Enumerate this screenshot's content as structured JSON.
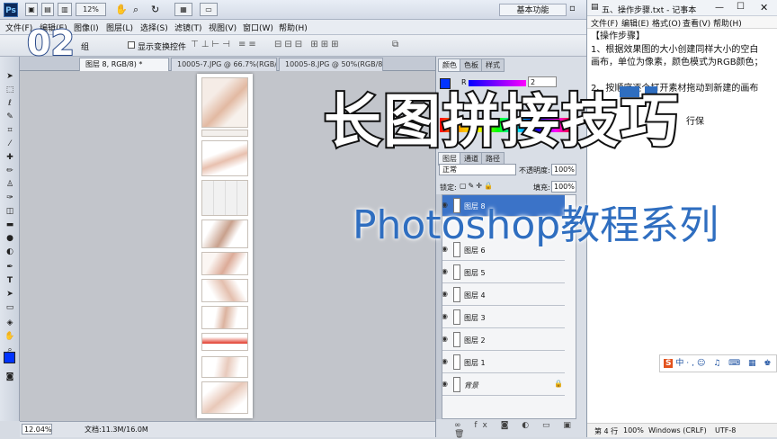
{
  "ps": {
    "logo": "Ps",
    "zoom_select": "12%",
    "workspace": "基本功能",
    "menu": [
      "文件(F)",
      "编辑(E)",
      "图像(I)",
      "图层(L)",
      "选择(S)",
      "滤镜(T)",
      "视图(V)",
      "窗口(W)",
      "帮助(H)"
    ],
    "options": {
      "group_label": "组",
      "transform_label": "显示变换控件"
    },
    "tabs": [
      "图层 8, RGB/8) *",
      "10005-7.JPG @ 66.7%(RGB/8#)",
      "10005-8.JPG @ 50%(RGB/8#)"
    ],
    "status": {
      "zoom": "12.04%",
      "doc_size": "文档:11.3M/16.0M"
    },
    "color_panel": {
      "tabs": [
        "颜色",
        "色板",
        "样式"
      ],
      "r_label": "R",
      "r_value": "2"
    },
    "layers_panel": {
      "tabs": [
        "图层",
        "通道",
        "路径"
      ],
      "blend_mode": "正常",
      "opacity_label": "不透明度:",
      "opacity": "100%",
      "lock_label": "锁定:",
      "fill_label": "填充:",
      "fill": "100%",
      "layers": [
        {
          "name": "图层 8",
          "selected": true
        },
        {
          "name": "图层 6",
          "selected": false
        },
        {
          "name": "图层 5",
          "selected": false
        },
        {
          "name": "图层 4",
          "selected": false
        },
        {
          "name": "图层 3",
          "selected": false
        },
        {
          "name": "图层 2",
          "selected": false
        },
        {
          "name": "图层 1",
          "selected": false
        },
        {
          "name": "背景",
          "selected": false
        }
      ]
    }
  },
  "notepad": {
    "title": "五、操作步骤.txt - 记事本",
    "menu": [
      "文件(F)",
      "编辑(E)",
      "格式(O)",
      "查看(V)",
      "帮助(H)"
    ],
    "lines": [
      "【操作步骤】",
      "1、根据效果图的大小创建同样大小的空白",
      "画布，单位为像素，颜色模式为RGB颜色；",
      "",
      "2、按顺序逐个打开素材拖动到新建的画布"
    ],
    "partial_text": "行保",
    "status": {
      "pos": "第 4 行",
      "zoom": "100%",
      "eol": "Windows (CRLF)",
      "enc": "UTF-8"
    }
  },
  "overlay": {
    "episode": "02",
    "title": "长图拼接技巧",
    "subtitle": "Photoshop教程系列"
  },
  "ime": {
    "label": "中"
  },
  "colors": {
    "accent_blue": "#2f6ec0",
    "selection": "#3b73c8",
    "foreground": "#0033ff"
  }
}
